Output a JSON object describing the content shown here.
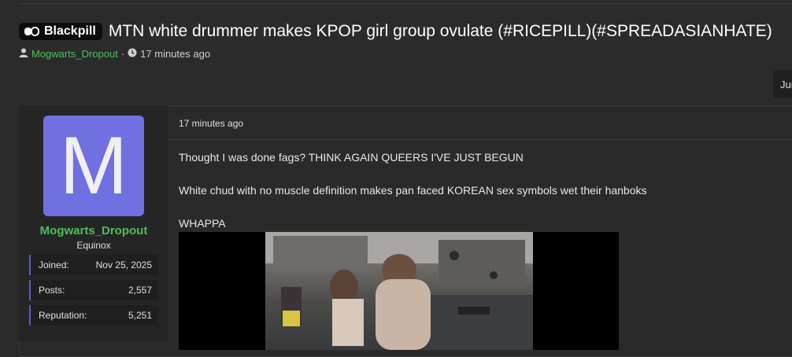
{
  "thread": {
    "prefix_label": "Blackpill",
    "title": "MTN white drummer makes KPOP girl group ovulate (#RICEPILL)(#SPREADASIANHATE)",
    "author": "Mogwarts_Dropout",
    "separator": "·",
    "time": "17 minutes ago"
  },
  "jump": {
    "label": "Jum"
  },
  "post": {
    "time": "17 minutes ago",
    "lines": [
      "Thought I was done fags? THINK AGAIN QUEERS I'VE JUST BEGUN",
      "White chud with no muscle definition makes pan faced KOREAN sex symbols wet their hanboks",
      "WHAPPA"
    ]
  },
  "user": {
    "avatar_letter": "M",
    "name": "Mogwarts_Dropout",
    "title": "Equinox",
    "stats": [
      {
        "label": "Joined:",
        "value": "Nov 25, 2025"
      },
      {
        "label": "Posts:",
        "value": "2,557"
      },
      {
        "label": "Reputation:",
        "value": "5,251"
      }
    ]
  },
  "colors": {
    "background": "#2b2b2b",
    "username_green": "#4cc05a",
    "avatar_purple": "#7070e0",
    "stat_accent": "#5b5bd6"
  },
  "icons": [
    "pill-icon",
    "user-icon",
    "clock-icon"
  ]
}
